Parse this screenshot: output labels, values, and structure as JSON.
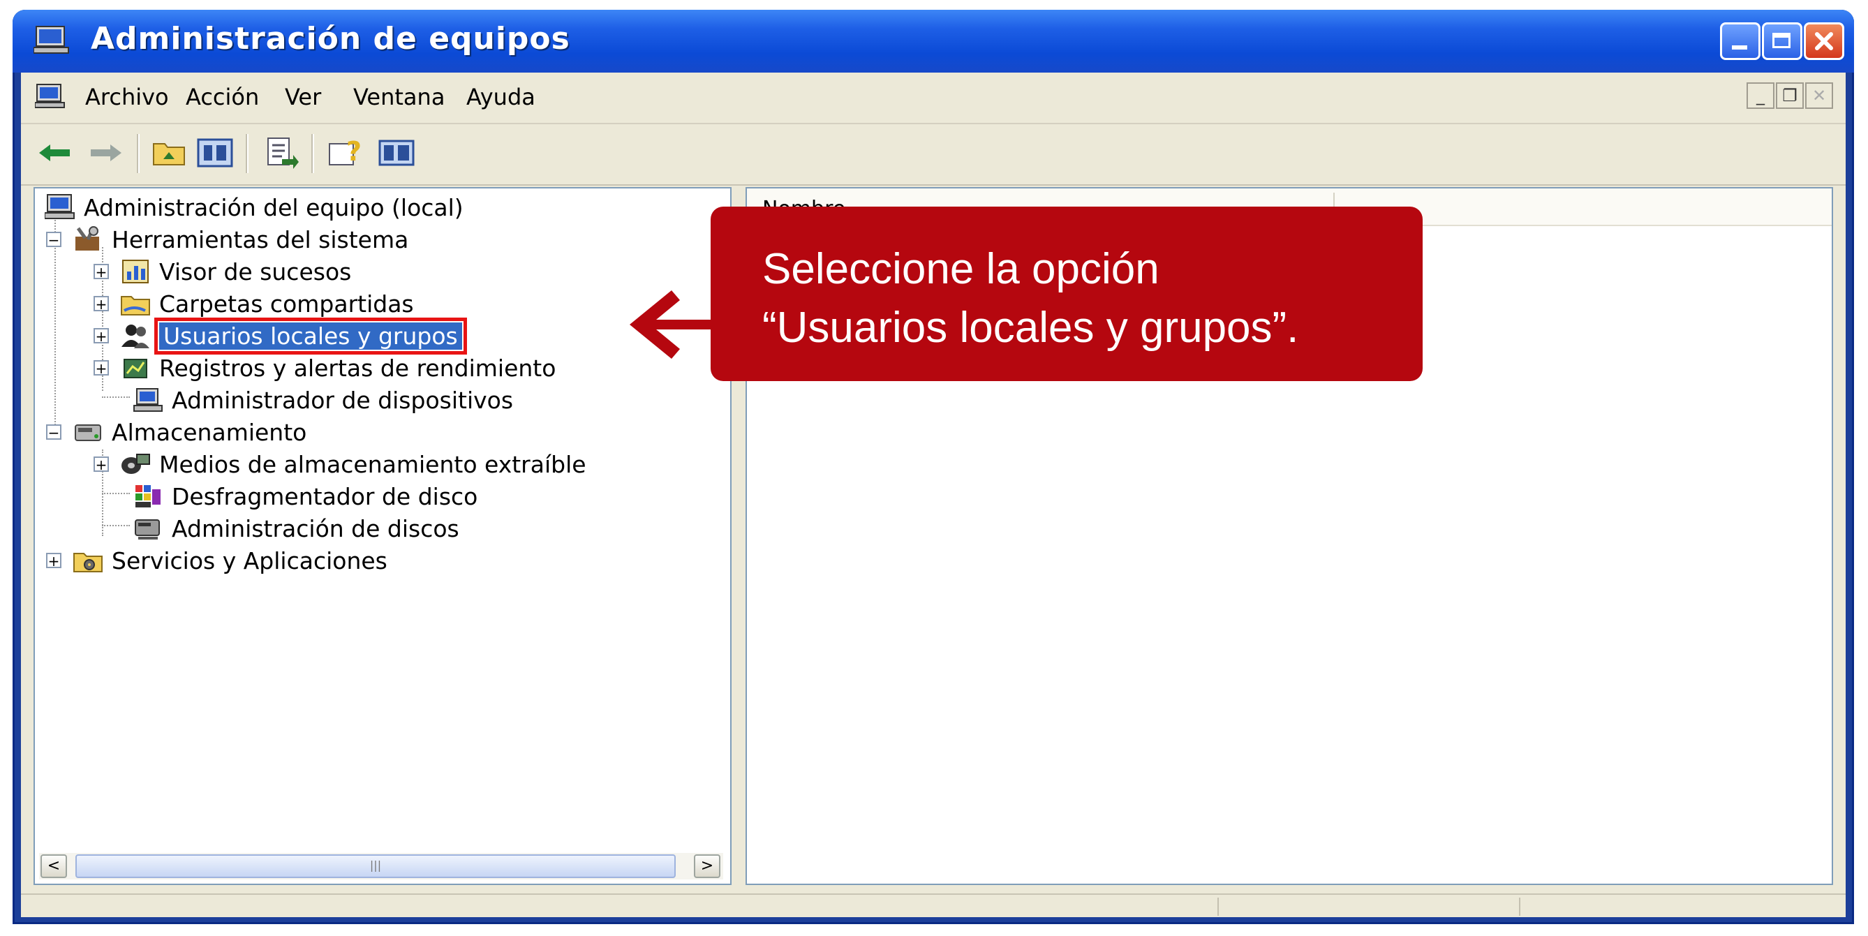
{
  "window": {
    "title": "Administración de equipos",
    "controls": {
      "minimize": "minimize-icon",
      "maximize": "maximize-icon",
      "close": "close-icon"
    }
  },
  "menubar": {
    "items": [
      "Archivo",
      "Acción",
      "Ver",
      "Ventana",
      "Ayuda"
    ]
  },
  "toolbar": {
    "buttons": [
      "back-arrow-icon",
      "forward-arrow-icon",
      "up-folder-icon",
      "show-hide-tree-icon",
      "export-list-icon",
      "help-icon",
      "console-icon"
    ]
  },
  "tree": {
    "root": "Administración del equipo (local)",
    "items": [
      "Herramientas del sistema",
      "Visor de sucesos",
      "Carpetas compartidas",
      "Usuarios locales y grupos",
      "Registros y alertas de rendimiento",
      "Administrador de dispositivos",
      "Almacenamiento",
      "Medios de almacenamiento extraíble",
      "Desfragmentador de disco",
      "Administración de discos",
      "Servicios y Aplicaciones"
    ],
    "selected": "Usuarios locales y grupos"
  },
  "list": {
    "column_header": "Nombre"
  },
  "callout": {
    "line1": "Seleccione la opción",
    "line2": "“Usuarios locales y grupos”."
  },
  "colors": {
    "titlebar": "#0b4ad6",
    "selection": "#316ac5",
    "highlight_border": "#e81414",
    "callout": "#b5070f"
  }
}
